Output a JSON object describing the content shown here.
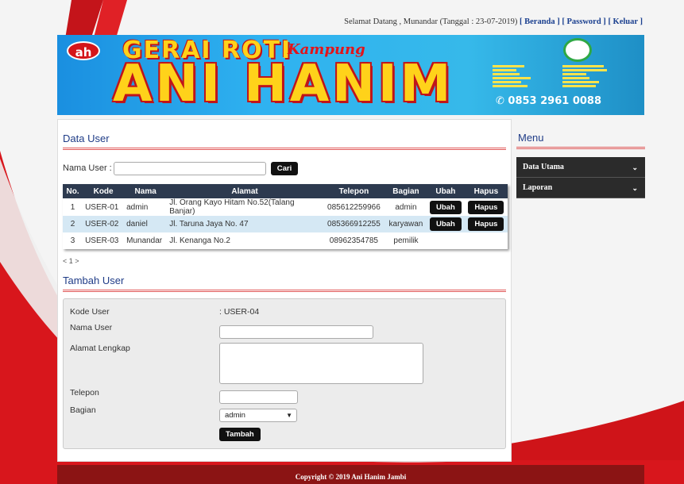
{
  "topbar": {
    "greeting": "Selamat Datang , Munandar (Tanggal : 23-07-2019)",
    "links": [
      "[ Beranda ]",
      "[ Password ]",
      "[ Keluar ]"
    ]
  },
  "banner": {
    "logo_text": "ah",
    "top_text": "GERAI ROTI",
    "script_text": "Kampung",
    "main_text": "ANI HANIM",
    "phone": "0853 2961 0088"
  },
  "data_user": {
    "title": "Data User",
    "search_label": "Nama User :",
    "search_value": "",
    "search_button": "Cari",
    "columns": [
      "No.",
      "Kode",
      "Nama",
      "Alamat",
      "Telepon",
      "Bagian",
      "Ubah",
      "Hapus"
    ],
    "rows": [
      {
        "no": "1",
        "kode": "USER-01",
        "nama": "admin",
        "alamat": "Jl. Orang Kayo Hitam No.52(Talang Banjar)",
        "telepon": "085612259966",
        "bagian": "admin",
        "ubah": "Ubah",
        "hapus": "Hapus"
      },
      {
        "no": "2",
        "kode": "USER-02",
        "nama": "daniel",
        "alamat": "Jl. Taruna Jaya No. 47",
        "telepon": "085366912255",
        "bagian": "karyawan",
        "ubah": "Ubah",
        "hapus": "Hapus"
      },
      {
        "no": "3",
        "kode": "USER-03",
        "nama": "Munandar",
        "alamat": "Jl. Kenanga No.2",
        "telepon": "08962354785",
        "bagian": "pemilik",
        "ubah": "",
        "hapus": ""
      }
    ],
    "pager": "< 1 >"
  },
  "tambah_user": {
    "title": "Tambah User",
    "labels": {
      "kode": "Kode User",
      "nama": "Nama User",
      "alamat": "Alamat Lengkap",
      "telepon": "Telepon",
      "bagian": "Bagian"
    },
    "kode_value": ": USER-04",
    "nama_value": "",
    "alamat_value": "",
    "telepon_value": "",
    "bagian_selected": "admin",
    "submit": "Tambah"
  },
  "sidebar": {
    "title": "Menu",
    "items": [
      {
        "label": "Data Utama",
        "icon": "chevron-down-icon"
      },
      {
        "label": "Laporan",
        "icon": "chevron-down-icon"
      }
    ]
  },
  "footer": {
    "text": "Copyright © 2019 Ani Hanim Jambi"
  },
  "colors": {
    "accent_red": "#c0141a",
    "title_blue": "#1f3c87",
    "table_header": "#2d3a4f",
    "row_alt": "#d5e8f4",
    "menu_dark": "#2b2b2b",
    "footer": "#8b1414"
  }
}
